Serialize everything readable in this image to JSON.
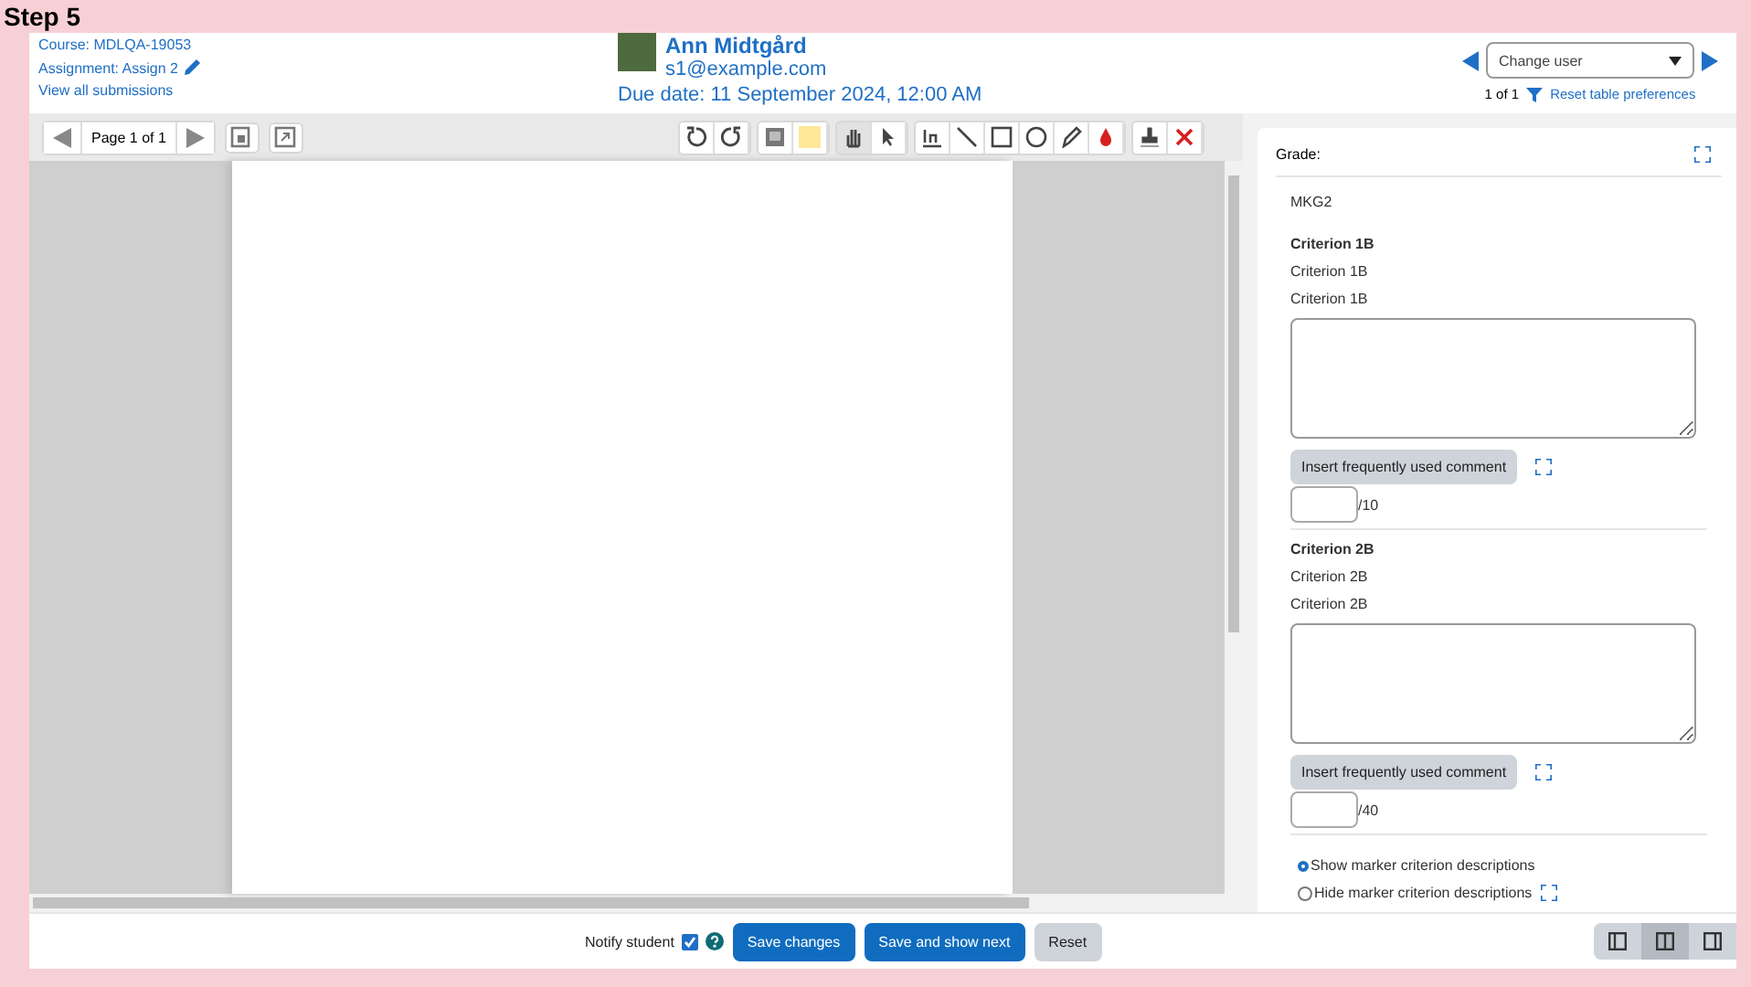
{
  "step": "Step 5",
  "header": {
    "course": "Course: MDLQA-19053",
    "assignment": "Assignment: Assign 2",
    "view_all": "View all submissions",
    "user_name": "Ann Midtgård",
    "user_email": "s1@example.com",
    "due_date": "Due date: 11 September 2024, 12:00 AM",
    "change_user": {
      "placeholder": "Change user"
    },
    "count": "1 of 1",
    "reset": "Reset table preferences"
  },
  "pager": {
    "label": "Page 1 of 1"
  },
  "tool_groups": [
    [
      {
        "kind": "rotate-left",
        "selected": false
      },
      {
        "kind": "rotate-right",
        "selected": false
      }
    ],
    [
      {
        "kind": "comment",
        "selected": false
      },
      {
        "kind": "color",
        "selected": false
      }
    ],
    [
      {
        "kind": "hand",
        "selected": true
      },
      {
        "kind": "pointer",
        "selected": false
      }
    ],
    [
      {
        "kind": "highlight",
        "selected": false
      },
      {
        "kind": "line",
        "selected": false
      },
      {
        "kind": "rectangle",
        "selected": false
      },
      {
        "kind": "oval",
        "selected": false
      },
      {
        "kind": "pen",
        "selected": false
      },
      {
        "kind": "drop",
        "selected": false
      }
    ],
    [
      {
        "kind": "stamp",
        "selected": false
      },
      {
        "kind": "delete",
        "selected": false
      }
    ]
  ],
  "grade": {
    "title": "Grade:",
    "guide_name": "MKG2",
    "criteria": [
      {
        "name": "Criterion 1B",
        "description": "Criterion 1B",
        "marker_description": "Criterion 1B",
        "comment_button": "Insert frequently used comment",
        "max": "/10"
      },
      {
        "name": "Criterion 2B",
        "description": "Criterion 2B",
        "marker_description": "Criterion 2B",
        "comment_button": "Insert frequently used comment",
        "max": "/40"
      }
    ],
    "options": [
      {
        "label": "Show marker criterion descriptions",
        "selected": true
      },
      {
        "label": "Hide marker criterion descriptions",
        "selected": false
      }
    ]
  },
  "footer": {
    "notify": {
      "label": "Notify student",
      "checked": true
    },
    "buttons": [
      {
        "label": "Save changes",
        "kind": "primary"
      },
      {
        "label": "Save and show next",
        "kind": "primary"
      },
      {
        "label": "Reset",
        "kind": "secondary"
      }
    ],
    "layouts": [
      {
        "kind": "left",
        "selected": false
      },
      {
        "kind": "both",
        "selected": true
      },
      {
        "kind": "right",
        "selected": false
      }
    ]
  }
}
